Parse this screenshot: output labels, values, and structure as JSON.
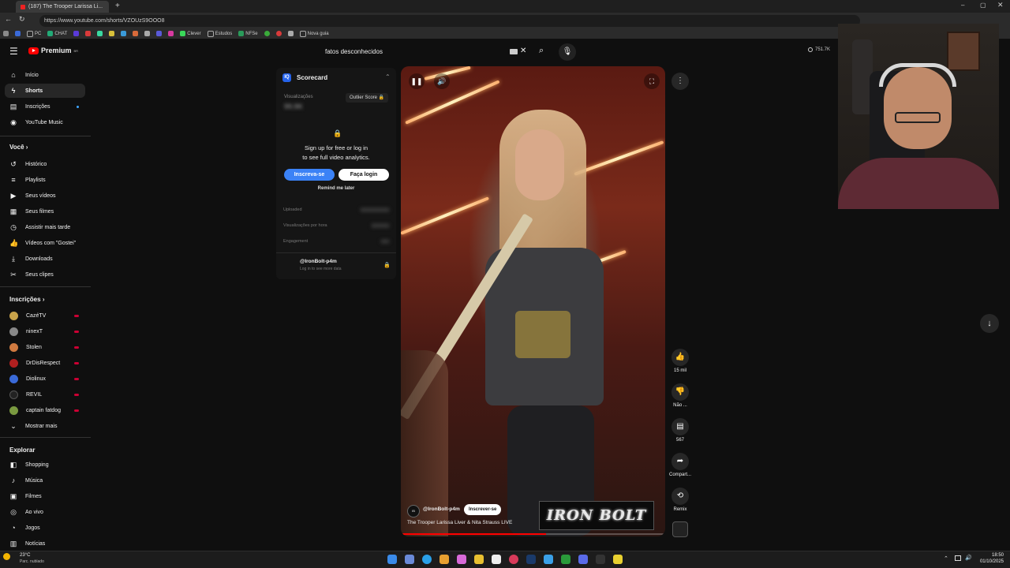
{
  "browser": {
    "tab_title": "(187) The Trooper Larissa Li...",
    "url": "https://www.youtube.com/shorts/VZOUzS9OOO8",
    "bookmarks": [
      "PC",
      "CHAT",
      "Clever",
      "Estudos",
      "NFSe",
      "Nova guia"
    ]
  },
  "header": {
    "logo_text": "Premium",
    "logo_sup": "BR",
    "search_value": "fatos desconhecidos",
    "views_counter": "751.7K"
  },
  "sidebar": {
    "main": [
      {
        "label": "Início",
        "icon": "home-icon"
      },
      {
        "label": "Shorts",
        "icon": "shorts-icon"
      },
      {
        "label": "Inscrições",
        "icon": "subscriptions-icon"
      },
      {
        "label": "YouTube Music",
        "icon": "music-icon"
      }
    ],
    "you_title": "Você",
    "you": [
      {
        "label": "Histórico",
        "icon": "history-icon"
      },
      {
        "label": "Playlists",
        "icon": "playlist-icon"
      },
      {
        "label": "Seus vídeos",
        "icon": "video-icon"
      },
      {
        "label": "Seus filmes",
        "icon": "film-icon"
      },
      {
        "label": "Assistir mais tarde",
        "icon": "clock-icon"
      },
      {
        "label": "Vídeos com \"Gostei\"",
        "icon": "like-icon"
      },
      {
        "label": "Downloads",
        "icon": "download-icon"
      },
      {
        "label": "Seus clipes",
        "icon": "scissors-icon"
      }
    ],
    "subs_title": "Inscrições",
    "subs": [
      {
        "label": "CazéTV",
        "color": "#c9a34a"
      },
      {
        "label": "ninexT",
        "color": "#888888"
      },
      {
        "label": "Stolen",
        "color": "#d07a40"
      },
      {
        "label": "DrDisRespect",
        "color": "#b02020"
      },
      {
        "label": "Diolinux",
        "color": "#3a6ad8"
      },
      {
        "label": "REVIL",
        "color": "#222222"
      },
      {
        "label": "captain fatdog",
        "color": "#7a9a40"
      }
    ],
    "show_more": "Mostrar mais",
    "explore_title": "Explorar",
    "explore": [
      {
        "label": "Shopping",
        "icon": "bag-icon"
      },
      {
        "label": "Música",
        "icon": "music-note-icon"
      },
      {
        "label": "Filmes",
        "icon": "clapper-icon"
      },
      {
        "label": "Ao vivo",
        "icon": "live-icon"
      },
      {
        "label": "Jogos",
        "icon": "gamepad-icon"
      },
      {
        "label": "Notícias",
        "icon": "news-icon"
      }
    ]
  },
  "scorecard": {
    "title": "Scorecard",
    "views_label": "Visualizações",
    "views_value": "99.9K",
    "outlier": "Outlier Score",
    "signup_line1": "Sign up for free or log in",
    "signup_line2": "to see full video analytics.",
    "subscribe_btn": "Inscreva-se",
    "login_btn": "Faça login",
    "remind": "Remind me later",
    "row1_label": "Uploaded",
    "row2_label": "Visualizações por hora",
    "row3_label": "Engagement",
    "channel": "@IronBolt-p4m",
    "channel_sub": "Log in to see more data"
  },
  "video": {
    "channel_handle": "@IronBolt-p4m",
    "subscribe": "Inscrever-se",
    "title": "The Trooper  Larissa Liver & Nita Strauss LIVE",
    "logo_text": "IRON BOLT",
    "progress": 0.55
  },
  "actions": {
    "likes": "15 mil",
    "dislike": "Não ...",
    "comments": "567",
    "share": "Compart...",
    "remix": "Remix"
  },
  "taskbar": {
    "weather_temp": "23°C",
    "weather_desc": "Parc. nublado",
    "time": "18:50",
    "date": "01/10/2025"
  }
}
